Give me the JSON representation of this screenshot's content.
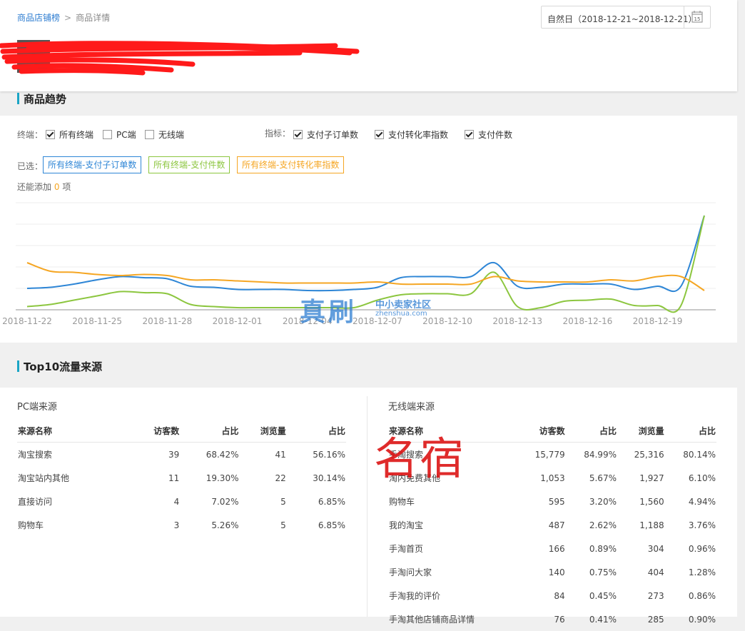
{
  "breadcrumb": {
    "parent": "商品店铺榜",
    "separator": ">",
    "current": "商品详情"
  },
  "date_range": {
    "label": "自然日（2018-12-21~2018-12-21）",
    "icon": "calendar-icon",
    "icon_text": "15"
  },
  "trend": {
    "title": "商品趋势",
    "terminal_label": "终端：",
    "terminals": [
      {
        "label": "所有终端",
        "checked": true
      },
      {
        "label": "PC端",
        "checked": false
      },
      {
        "label": "无线端",
        "checked": false
      }
    ],
    "metric_label": "指标：",
    "metrics": [
      {
        "label": "支付子订单数",
        "checked": true
      },
      {
        "label": "支付转化率指数",
        "checked": true
      },
      {
        "label": "支付件数",
        "checked": true
      }
    ],
    "selected_label": "已选：",
    "selected_tags": [
      {
        "label": "所有终端-支付子订单数",
        "color": "#2e86d6"
      },
      {
        "label": "所有终端-支付件数",
        "color": "#8cc63f"
      },
      {
        "label": "所有终端-支付转化率指数",
        "color": "#f5a623"
      }
    ],
    "can_add_prefix": "还能添加",
    "can_add_count": "0",
    "can_add_suffix": "项"
  },
  "chart_data": {
    "type": "line",
    "x_tick_labels": [
      "2018-11-22",
      "2018-11-25",
      "2018-11-28",
      "2018-12-01",
      "2018-12-04",
      "2018-12-07",
      "2018-12-10",
      "2018-12-13",
      "2018-12-16",
      "2018-12-19"
    ],
    "x": [
      "2018-11-22",
      "2018-11-23",
      "2018-11-24",
      "2018-11-25",
      "2018-11-26",
      "2018-11-27",
      "2018-11-28",
      "2018-11-29",
      "2018-11-30",
      "2018-12-01",
      "2018-12-02",
      "2018-12-03",
      "2018-12-04",
      "2018-12-05",
      "2018-12-06",
      "2018-12-07",
      "2018-12-08",
      "2018-12-09",
      "2018-12-10",
      "2018-12-11",
      "2018-12-12",
      "2018-12-13",
      "2018-12-14",
      "2018-12-15",
      "2018-12-16",
      "2018-12-17",
      "2018-12-18",
      "2018-12-19",
      "2018-12-20",
      "2018-12-21"
    ],
    "ylim": [
      0,
      50
    ],
    "grid": true,
    "series": [
      {
        "name": "所有终端-支付子订单数",
        "color": "#2e86d6",
        "values": [
          10,
          10.5,
          12,
          14,
          15.5,
          15,
          14.5,
          11,
          10.5,
          9.5,
          9.5,
          9.5,
          9,
          9,
          9.5,
          10.5,
          15,
          15.5,
          15.5,
          15.5,
          22,
          11,
          10.5,
          12,
          12,
          12,
          9.5,
          11,
          11,
          44
        ]
      },
      {
        "name": "所有终端-支付件数",
        "color": "#8cc63f",
        "values": [
          1.5,
          2.5,
          4.5,
          6.5,
          8.5,
          8,
          7.5,
          2.5,
          1.5,
          1,
          1,
          1,
          1,
          1,
          1,
          4.5,
          7,
          7.5,
          7.5,
          7.5,
          17.5,
          1.5,
          1,
          4,
          4.5,
          5,
          2,
          2,
          2,
          44
        ]
      },
      {
        "name": "所有终端-支付转化率指数",
        "color": "#f5a623",
        "values": [
          22,
          18,
          17.5,
          16.5,
          16,
          16.5,
          16,
          14,
          14,
          13.5,
          13,
          12.5,
          12.5,
          12.5,
          12.5,
          13,
          12,
          12,
          12,
          12,
          15.5,
          13.5,
          13,
          13,
          13,
          14,
          13.5,
          15.5,
          15.5,
          9
        ]
      }
    ]
  },
  "top10": {
    "title": "Top10流量来源",
    "pc": {
      "title": "PC端来源",
      "columns": [
        "来源名称",
        "访客数",
        "占比",
        "浏览量",
        "占比"
      ],
      "rows": [
        [
          "淘宝搜索",
          "39",
          "68.42%",
          "41",
          "56.16%"
        ],
        [
          "淘宝站内其他",
          "11",
          "19.30%",
          "22",
          "30.14%"
        ],
        [
          "直接访问",
          "4",
          "7.02%",
          "5",
          "6.85%"
        ],
        [
          "购物车",
          "3",
          "5.26%",
          "5",
          "6.85%"
        ]
      ]
    },
    "mobile": {
      "title": "无线端来源",
      "columns": [
        "来源名称",
        "访客数",
        "占比",
        "浏览量",
        "占比"
      ],
      "rows": [
        [
          "手淘搜索",
          "15,779",
          "84.99%",
          "25,316",
          "80.14%"
        ],
        [
          "淘内免费其他",
          "1,053",
          "5.67%",
          "1,927",
          "6.10%"
        ],
        [
          "购物车",
          "595",
          "3.20%",
          "1,560",
          "4.94%"
        ],
        [
          "我的淘宝",
          "487",
          "2.62%",
          "1,188",
          "3.76%"
        ],
        [
          "手淘首页",
          "166",
          "0.89%",
          "304",
          "0.96%"
        ],
        [
          "手淘问大家",
          "140",
          "0.75%",
          "404",
          "1.28%"
        ],
        [
          "手淘我的评价",
          "84",
          "0.45%",
          "273",
          "0.86%"
        ],
        [
          "手淘其他店铺商品详情",
          "76",
          "0.41%",
          "285",
          "0.90%"
        ]
      ]
    }
  },
  "watermarks": {
    "brand": "真刷",
    "brand_sub": "中小卖家社区",
    "brand_url": "zhenshua.com",
    "stamp": "名宿"
  }
}
